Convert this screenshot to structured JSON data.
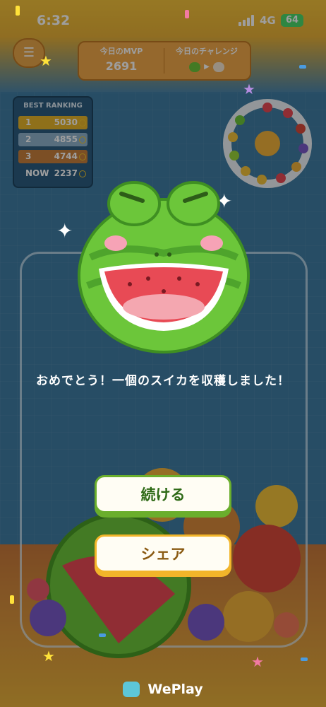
{
  "status_bar": {
    "time": "6:32",
    "network": "4G",
    "battery": "64"
  },
  "header": {
    "menu_icon": "menu-list-icon",
    "mvp_label": "今日のMVP",
    "mvp_value": "2691",
    "challenge_label": "今日のチャレンジ"
  },
  "ranking": {
    "title": "BEST RANKING",
    "rows": [
      {
        "rank": "1",
        "score": "5030",
        "color": "#e7b52a"
      },
      {
        "rank": "2",
        "score": "4855",
        "color": "#8fb2cc"
      },
      {
        "rank": "3",
        "score": "4744",
        "color": "#c9803d"
      },
      {
        "rank": "NOW",
        "score": "2237",
        "color": "#2d5d80"
      }
    ]
  },
  "dialog": {
    "message": "おめでとう！一個のスイカを収穫しました！",
    "continue_label": "続ける",
    "share_label": "シェア"
  },
  "footer": {
    "brand": "WePlay"
  },
  "colors": {
    "continue_accent": "#6aae2c",
    "share_accent": "#f2b52a",
    "watermelon_rind": "#6cc63a",
    "watermelon_flesh": "#e84a55"
  }
}
